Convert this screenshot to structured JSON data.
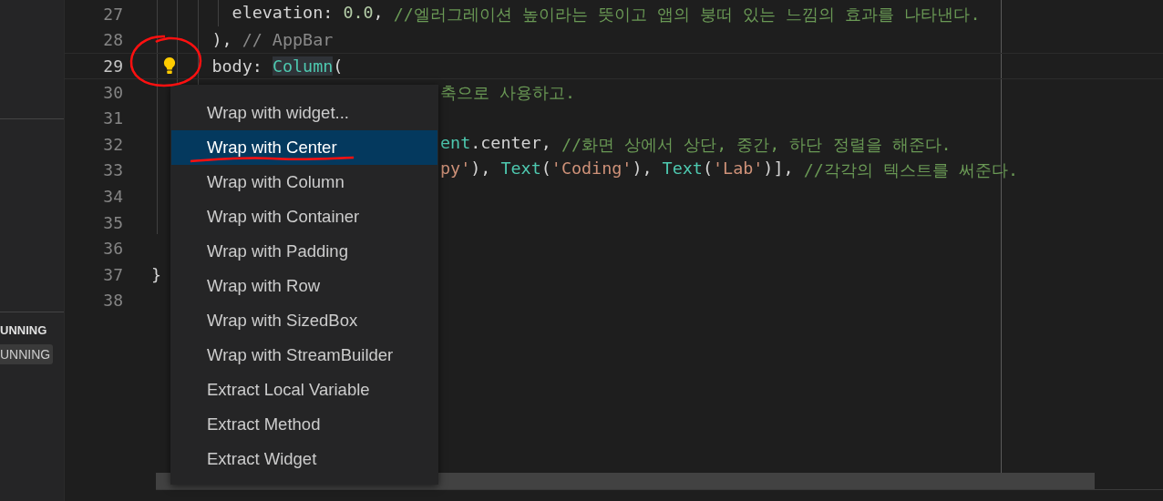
{
  "sidebar": {
    "items": [
      {
        "label": "UNNING",
        "kind": "heading"
      },
      {
        "label": "UNNING",
        "kind": "badge"
      }
    ]
  },
  "editor": {
    "lines": [
      {
        "number": "27",
        "current": false,
        "tokens": [
          {
            "text": "        elevation: ",
            "kind": "plain"
          },
          {
            "text": "0.0",
            "kind": "number"
          },
          {
            "text": ", ",
            "kind": "plain"
          },
          {
            "text": "//엘러그레이션 높이라는 뜻이고 앱의 붕떠 있는 느낌의 효과를 나타낸다.",
            "kind": "comment"
          }
        ]
      },
      {
        "number": "28",
        "current": false,
        "tokens": [
          {
            "text": "      ), ",
            "kind": "plain"
          },
          {
            "text": "// AppBar",
            "kind": "hint"
          }
        ]
      },
      {
        "number": "29",
        "current": true,
        "tokens": [
          {
            "text": "      body: ",
            "kind": "plain"
          },
          {
            "text": "Column",
            "kind": "class",
            "highlighted": true
          },
          {
            "text": "(",
            "kind": "plain"
          }
        ]
      },
      {
        "number": "30",
        "current": false,
        "behind_menu": true,
        "tokens": [
          {
            "text": "축으로 사용하고.",
            "kind": "comment"
          }
        ]
      },
      {
        "number": "31",
        "current": false
      },
      {
        "number": "32",
        "current": false,
        "behind_menu": true,
        "tokens": [
          {
            "text": "ent",
            "kind": "class"
          },
          {
            "text": ".center, ",
            "kind": "plain"
          },
          {
            "text": "//화면 상에서 상단, 중간, 하단 정렬을 해준다.",
            "kind": "comment"
          }
        ]
      },
      {
        "number": "33",
        "current": false,
        "behind_menu": true,
        "tokens": [
          {
            "text": "py'",
            "kind": "string"
          },
          {
            "text": "), ",
            "kind": "plain"
          },
          {
            "text": "Text",
            "kind": "class"
          },
          {
            "text": "(",
            "kind": "plain"
          },
          {
            "text": "'Coding'",
            "kind": "string"
          },
          {
            "text": "), ",
            "kind": "plain"
          },
          {
            "text": "Text",
            "kind": "class"
          },
          {
            "text": "(",
            "kind": "plain"
          },
          {
            "text": "'Lab'",
            "kind": "string"
          },
          {
            "text": ")], ",
            "kind": "plain"
          },
          {
            "text": "//각각의 텍스트를 써준다.",
            "kind": "comment"
          }
        ]
      },
      {
        "number": "34",
        "current": false
      },
      {
        "number": "35",
        "current": false
      },
      {
        "number": "36",
        "current": false
      },
      {
        "number": "37",
        "current": false,
        "tokens": [
          {
            "text": "}",
            "kind": "plain"
          }
        ]
      },
      {
        "number": "38",
        "current": false
      }
    ]
  },
  "context_menu": {
    "items": [
      {
        "label": "Wrap with widget...",
        "selected": false
      },
      {
        "label": "Wrap with Center",
        "selected": true
      },
      {
        "label": "Wrap with Column",
        "selected": false
      },
      {
        "label": "Wrap with Container",
        "selected": false
      },
      {
        "label": "Wrap with Padding",
        "selected": false
      },
      {
        "label": "Wrap with Row",
        "selected": false
      },
      {
        "label": "Wrap with SizedBox",
        "selected": false
      },
      {
        "label": "Wrap with StreamBuilder",
        "selected": false
      },
      {
        "label": "Extract Local Variable",
        "selected": false
      },
      {
        "label": "Extract Method",
        "selected": false
      },
      {
        "label": "Extract Widget",
        "selected": false
      }
    ]
  }
}
